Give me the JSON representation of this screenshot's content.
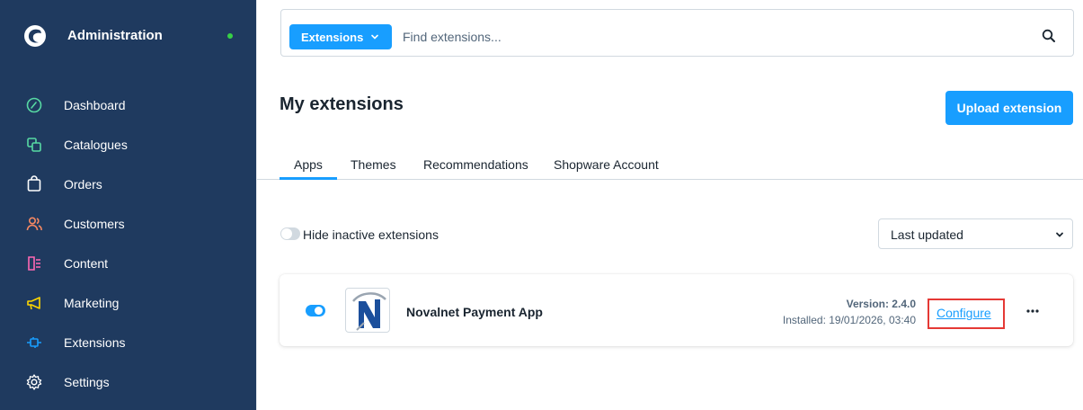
{
  "sidebar": {
    "title": "Administration",
    "items": [
      {
        "label": "Dashboard",
        "icon": "gauge-icon",
        "color": "#57d9a3"
      },
      {
        "label": "Catalogues",
        "icon": "catalogue-icon",
        "color": "#57d9a3"
      },
      {
        "label": "Orders",
        "icon": "orders-bag-icon",
        "color": "#ffffff"
      },
      {
        "label": "Customers",
        "icon": "customers-icon",
        "color": "#f88962"
      },
      {
        "label": "Content",
        "icon": "content-icon",
        "color": "#ff68b4"
      },
      {
        "label": "Marketing",
        "icon": "megaphone-icon",
        "color": "#ffd700"
      },
      {
        "label": "Extensions",
        "icon": "plug-icon",
        "color": "#189eff"
      },
      {
        "label": "Settings",
        "icon": "gear-icon",
        "color": "#ffffff"
      }
    ]
  },
  "search": {
    "scope_label": "Extensions",
    "placeholder": "Find extensions..."
  },
  "page": {
    "title": "My extensions",
    "upload_label": "Upload extension"
  },
  "tabs": [
    {
      "label": "Apps",
      "active": true
    },
    {
      "label": "Themes",
      "active": false
    },
    {
      "label": "Recommendations",
      "active": false
    },
    {
      "label": "Shopware Account",
      "active": false
    }
  ],
  "filters": {
    "hide_inactive_label": "Hide inactive extensions",
    "hide_inactive_on": false,
    "sort_label": "Last updated"
  },
  "extensions": [
    {
      "name": "Novalnet Payment App",
      "logo_letter": "N",
      "active": true,
      "version": "Version: 2.4.0",
      "installed": "Installed: 19/01/2026, 03:40",
      "action_label": "Configure"
    }
  ],
  "colors": {
    "sidebar_bg": "#1f3a5f",
    "accent": "#189eff",
    "status_dot": "#37d046",
    "highlight": "#e53935"
  }
}
